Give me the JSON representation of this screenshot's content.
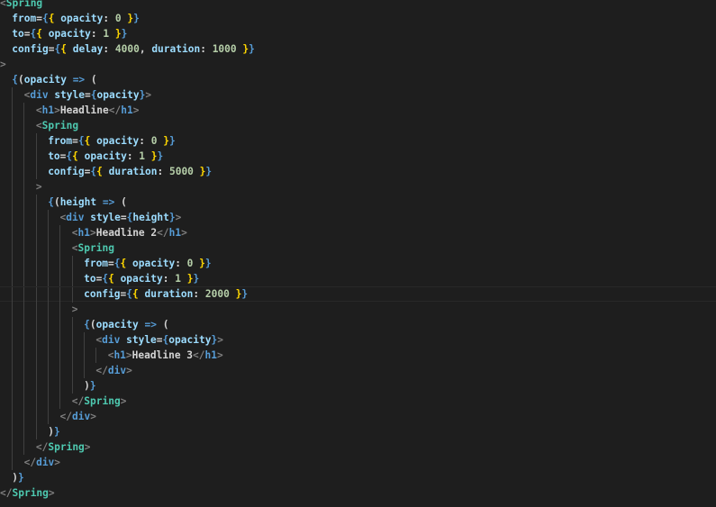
{
  "editor": {
    "language": "jsx",
    "lines": [
      {
        "indent": 0,
        "current": false,
        "tokens": [
          [
            "<",
            "br"
          ],
          [
            "Spring",
            "tag"
          ]
        ]
      },
      {
        "indent": 1,
        "current": false,
        "tokens": [
          [
            "from",
            "prop"
          ],
          [
            "=",
            "punc"
          ],
          [
            "{",
            "brace"
          ],
          [
            "{ ",
            "yellow"
          ],
          [
            "opacity",
            "prop"
          ],
          [
            ": ",
            "punc"
          ],
          [
            "0",
            "num"
          ],
          [
            " }",
            "yellow"
          ],
          [
            "}",
            "brace"
          ]
        ]
      },
      {
        "indent": 1,
        "current": false,
        "tokens": [
          [
            "to",
            "prop"
          ],
          [
            "=",
            "punc"
          ],
          [
            "{",
            "brace"
          ],
          [
            "{ ",
            "yellow"
          ],
          [
            "opacity",
            "prop"
          ],
          [
            ": ",
            "punc"
          ],
          [
            "1",
            "num"
          ],
          [
            " }",
            "yellow"
          ],
          [
            "}",
            "brace"
          ]
        ]
      },
      {
        "indent": 1,
        "current": false,
        "tokens": [
          [
            "config",
            "prop"
          ],
          [
            "=",
            "punc"
          ],
          [
            "{",
            "brace"
          ],
          [
            "{ ",
            "yellow"
          ],
          [
            "delay",
            "prop"
          ],
          [
            ": ",
            "punc"
          ],
          [
            "4000",
            "num"
          ],
          [
            ", ",
            "punc"
          ],
          [
            "duration",
            "prop"
          ],
          [
            ": ",
            "punc"
          ],
          [
            "1000",
            "num"
          ],
          [
            " }",
            "yellow"
          ],
          [
            "}",
            "brace"
          ]
        ]
      },
      {
        "indent": 0,
        "current": false,
        "tokens": [
          [
            ">",
            "br"
          ]
        ]
      },
      {
        "indent": 1,
        "current": false,
        "tokens": [
          [
            "{",
            "brace"
          ],
          [
            "(",
            "punc"
          ],
          [
            "opacity",
            "var"
          ],
          [
            " => ",
            "arrow"
          ],
          [
            "(",
            "punc"
          ]
        ]
      },
      {
        "indent": 2,
        "current": false,
        "tokens": [
          [
            "<",
            "br"
          ],
          [
            "div",
            "html"
          ],
          [
            " ",
            "text"
          ],
          [
            "style",
            "prop"
          ],
          [
            "=",
            "punc"
          ],
          [
            "{",
            "brace"
          ],
          [
            "opacity",
            "var"
          ],
          [
            "}",
            "brace"
          ],
          [
            ">",
            "br"
          ]
        ]
      },
      {
        "indent": 3,
        "current": false,
        "tokens": [
          [
            "<",
            "br"
          ],
          [
            "h1",
            "html"
          ],
          [
            ">",
            "br"
          ],
          [
            "Headline",
            "text"
          ],
          [
            "</",
            "br"
          ],
          [
            "h1",
            "html"
          ],
          [
            ">",
            "br"
          ]
        ]
      },
      {
        "indent": 3,
        "current": false,
        "tokens": [
          [
            "<",
            "br"
          ],
          [
            "Spring",
            "tag"
          ]
        ]
      },
      {
        "indent": 4,
        "current": false,
        "tokens": [
          [
            "from",
            "prop"
          ],
          [
            "=",
            "punc"
          ],
          [
            "{",
            "brace"
          ],
          [
            "{ ",
            "yellow"
          ],
          [
            "opacity",
            "prop"
          ],
          [
            ": ",
            "punc"
          ],
          [
            "0",
            "num"
          ],
          [
            " }",
            "yellow"
          ],
          [
            "}",
            "brace"
          ]
        ]
      },
      {
        "indent": 4,
        "current": false,
        "tokens": [
          [
            "to",
            "prop"
          ],
          [
            "=",
            "punc"
          ],
          [
            "{",
            "brace"
          ],
          [
            "{ ",
            "yellow"
          ],
          [
            "opacity",
            "prop"
          ],
          [
            ": ",
            "punc"
          ],
          [
            "1",
            "num"
          ],
          [
            " }",
            "yellow"
          ],
          [
            "}",
            "brace"
          ]
        ]
      },
      {
        "indent": 4,
        "current": false,
        "tokens": [
          [
            "config",
            "prop"
          ],
          [
            "=",
            "punc"
          ],
          [
            "{",
            "brace"
          ],
          [
            "{ ",
            "yellow"
          ],
          [
            "duration",
            "prop"
          ],
          [
            ": ",
            "punc"
          ],
          [
            "5000",
            "num"
          ],
          [
            " }",
            "yellow"
          ],
          [
            "}",
            "brace"
          ]
        ]
      },
      {
        "indent": 3,
        "current": false,
        "tokens": [
          [
            ">",
            "br"
          ]
        ]
      },
      {
        "indent": 4,
        "current": false,
        "tokens": [
          [
            "{",
            "brace"
          ],
          [
            "(",
            "punc"
          ],
          [
            "height",
            "var"
          ],
          [
            " => ",
            "arrow"
          ],
          [
            "(",
            "punc"
          ]
        ]
      },
      {
        "indent": 5,
        "current": false,
        "tokens": [
          [
            "<",
            "br"
          ],
          [
            "div",
            "html"
          ],
          [
            " ",
            "text"
          ],
          [
            "style",
            "prop"
          ],
          [
            "=",
            "punc"
          ],
          [
            "{",
            "brace"
          ],
          [
            "height",
            "var"
          ],
          [
            "}",
            "brace"
          ],
          [
            ">",
            "br"
          ]
        ]
      },
      {
        "indent": 6,
        "current": false,
        "tokens": [
          [
            "<",
            "br"
          ],
          [
            "h1",
            "html"
          ],
          [
            ">",
            "br"
          ],
          [
            "Headline 2",
            "text"
          ],
          [
            "</",
            "br"
          ],
          [
            "h1",
            "html"
          ],
          [
            ">",
            "br"
          ]
        ]
      },
      {
        "indent": 6,
        "current": false,
        "tokens": [
          [
            "<",
            "br"
          ],
          [
            "Spring",
            "tag"
          ]
        ]
      },
      {
        "indent": 7,
        "current": false,
        "tokens": [
          [
            "from",
            "prop"
          ],
          [
            "=",
            "punc"
          ],
          [
            "{",
            "brace"
          ],
          [
            "{ ",
            "yellow"
          ],
          [
            "opacity",
            "prop"
          ],
          [
            ": ",
            "punc"
          ],
          [
            "0",
            "num"
          ],
          [
            " }",
            "yellow"
          ],
          [
            "}",
            "brace"
          ]
        ]
      },
      {
        "indent": 7,
        "current": false,
        "tokens": [
          [
            "to",
            "prop"
          ],
          [
            "=",
            "punc"
          ],
          [
            "{",
            "brace"
          ],
          [
            "{ ",
            "yellow"
          ],
          [
            "opacity",
            "prop"
          ],
          [
            ": ",
            "punc"
          ],
          [
            "1",
            "num"
          ],
          [
            " }",
            "yellow"
          ],
          [
            "}",
            "brace"
          ]
        ]
      },
      {
        "indent": 7,
        "current": true,
        "tokens": [
          [
            "config",
            "prop"
          ],
          [
            "=",
            "punc"
          ],
          [
            "{",
            "brace"
          ],
          [
            "{ ",
            "yellow"
          ],
          [
            "duration",
            "prop"
          ],
          [
            ": ",
            "punc"
          ],
          [
            "2000",
            "num"
          ],
          [
            " }",
            "yellow"
          ],
          [
            "}",
            "brace"
          ]
        ]
      },
      {
        "indent": 6,
        "current": false,
        "tokens": [
          [
            ">",
            "br"
          ]
        ]
      },
      {
        "indent": 7,
        "current": false,
        "tokens": [
          [
            "{",
            "brace"
          ],
          [
            "(",
            "punc"
          ],
          [
            "opacity",
            "var"
          ],
          [
            " => ",
            "arrow"
          ],
          [
            "(",
            "punc"
          ]
        ]
      },
      {
        "indent": 8,
        "current": false,
        "tokens": [
          [
            "<",
            "br"
          ],
          [
            "div",
            "html"
          ],
          [
            " ",
            "text"
          ],
          [
            "style",
            "prop"
          ],
          [
            "=",
            "punc"
          ],
          [
            "{",
            "brace"
          ],
          [
            "opacity",
            "var"
          ],
          [
            "}",
            "brace"
          ],
          [
            ">",
            "br"
          ]
        ]
      },
      {
        "indent": 9,
        "current": false,
        "tokens": [
          [
            "<",
            "br"
          ],
          [
            "h1",
            "html"
          ],
          [
            ">",
            "br"
          ],
          [
            "Headline 3",
            "text"
          ],
          [
            "</",
            "br"
          ],
          [
            "h1",
            "html"
          ],
          [
            ">",
            "br"
          ]
        ]
      },
      {
        "indent": 8,
        "current": false,
        "tokens": [
          [
            "</",
            "br"
          ],
          [
            "div",
            "html"
          ],
          [
            ">",
            "br"
          ]
        ]
      },
      {
        "indent": 7,
        "current": false,
        "tokens": [
          [
            ")",
            "punc"
          ],
          [
            "}",
            "brace"
          ]
        ]
      },
      {
        "indent": 6,
        "current": false,
        "tokens": [
          [
            "</",
            "br"
          ],
          [
            "Spring",
            "tag"
          ],
          [
            ">",
            "br"
          ]
        ]
      },
      {
        "indent": 5,
        "current": false,
        "tokens": [
          [
            "</",
            "br"
          ],
          [
            "div",
            "html"
          ],
          [
            ">",
            "br"
          ]
        ]
      },
      {
        "indent": 4,
        "current": false,
        "tokens": [
          [
            ")",
            "punc"
          ],
          [
            "}",
            "brace"
          ]
        ]
      },
      {
        "indent": 3,
        "current": false,
        "tokens": [
          [
            "</",
            "br"
          ],
          [
            "Spring",
            "tag"
          ],
          [
            ">",
            "br"
          ]
        ]
      },
      {
        "indent": 2,
        "current": false,
        "tokens": [
          [
            "</",
            "br"
          ],
          [
            "div",
            "html"
          ],
          [
            ">",
            "br"
          ]
        ]
      },
      {
        "indent": 1,
        "current": false,
        "tokens": [
          [
            ")",
            "punc"
          ],
          [
            "}",
            "brace"
          ]
        ]
      },
      {
        "indent": 0,
        "current": false,
        "tokens": [
          [
            "</",
            "br"
          ],
          [
            "Spring",
            "tag"
          ],
          [
            ">",
            "br"
          ]
        ]
      }
    ]
  }
}
